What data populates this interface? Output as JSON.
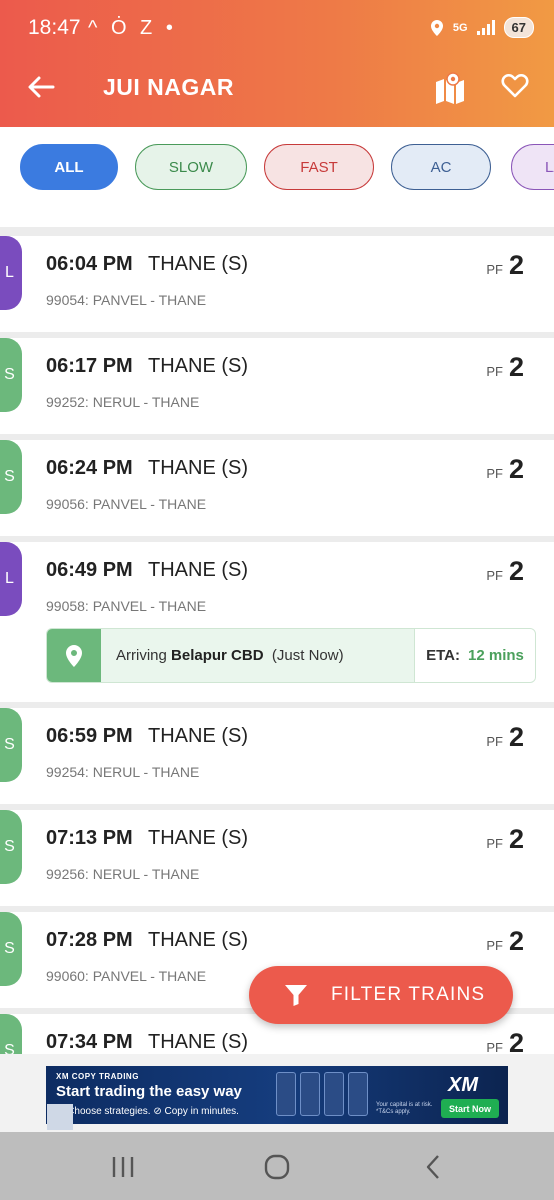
{
  "status_bar": {
    "time": "18:47",
    "notif_icons": "^ Ȯ Z •",
    "network": "5G",
    "battery": "67"
  },
  "app_bar": {
    "title": "JUI NAGAR",
    "back_icon": "arrow-left-icon",
    "map_icon": "map-pin-icon",
    "favorite_icon": "heart-outline-icon"
  },
  "filters": [
    {
      "label": "ALL",
      "selected": true,
      "fill": "#3b7be0",
      "border": "#3b7be0",
      "text": "#ffffff"
    },
    {
      "label": "SLOW",
      "selected": false,
      "fill": "#e6f3e9",
      "border": "#4a9a5a",
      "text": "#3b8a4b"
    },
    {
      "label": "FAST",
      "selected": false,
      "fill": "#f7e3e3",
      "border": "#c73a3a",
      "text": "#c73a3a"
    },
    {
      "label": "AC",
      "selected": false,
      "fill": "#e3ebf6",
      "border": "#3d5f93",
      "text": "#3d5f93"
    },
    {
      "label": "LA",
      "selected": false,
      "fill": "#efe4f6",
      "border": "#8a55b8",
      "text": "#8a55b8"
    }
  ],
  "colors": {
    "slow": "#6cb87c",
    "ladies": "#7a4cbe",
    "accent": "#ec5a4c"
  },
  "trains": [
    {
      "tag": "L",
      "type": "ladies",
      "time": "06:04 PM",
      "destination": "THANE (S)",
      "route": "99054: PANVEL - THANE",
      "pf_label": "PF",
      "platform": "2"
    },
    {
      "tag": "S",
      "type": "slow",
      "time": "06:17 PM",
      "destination": "THANE (S)",
      "route": "99252: NERUL - THANE",
      "pf_label": "PF",
      "platform": "2"
    },
    {
      "tag": "S",
      "type": "slow",
      "time": "06:24 PM",
      "destination": "THANE (S)",
      "route": "99056: PANVEL - THANE",
      "pf_label": "PF",
      "platform": "2"
    },
    {
      "tag": "L",
      "type": "ladies",
      "time": "06:49 PM",
      "destination": "THANE (S)",
      "route": "99058: PANVEL - THANE",
      "pf_label": "PF",
      "platform": "2",
      "live": {
        "prefix": "Arriving",
        "station": "Belapur CBD",
        "when": "(Just Now)",
        "eta_label": "ETA:",
        "eta_value": "12 mins"
      }
    },
    {
      "tag": "S",
      "type": "slow",
      "time": "06:59 PM",
      "destination": "THANE (S)",
      "route": "99254: NERUL - THANE",
      "pf_label": "PF",
      "platform": "2"
    },
    {
      "tag": "S",
      "type": "slow",
      "time": "07:13 PM",
      "destination": "THANE (S)",
      "route": "99256: NERUL - THANE",
      "pf_label": "PF",
      "platform": "2"
    },
    {
      "tag": "S",
      "type": "slow",
      "time": "07:28 PM",
      "destination": "THANE (S)",
      "route": "99060: PANVEL - THANE",
      "pf_label": "PF",
      "platform": "2"
    },
    {
      "tag": "S",
      "type": "slow",
      "time": "07:34 PM",
      "destination": "THANE (S)",
      "route": "",
      "pf_label": "PF",
      "platform": "2"
    }
  ],
  "fab": {
    "label": "FILTER TRAINS",
    "icon": "filter-funnel-icon"
  },
  "ad": {
    "kicker": "XM COPY TRADING",
    "headline": "Start trading the easy way",
    "sub": "⊘ Choose strategies.   ⊘ Copy in minutes.",
    "logo": "XM",
    "risk": "Your capital is at risk. *T&Cs apply.",
    "cta": "Start Now"
  },
  "nav": {
    "recent_icon": "recent-apps-icon",
    "home_icon": "home-circle-icon",
    "back_icon": "back-chevron-icon"
  }
}
